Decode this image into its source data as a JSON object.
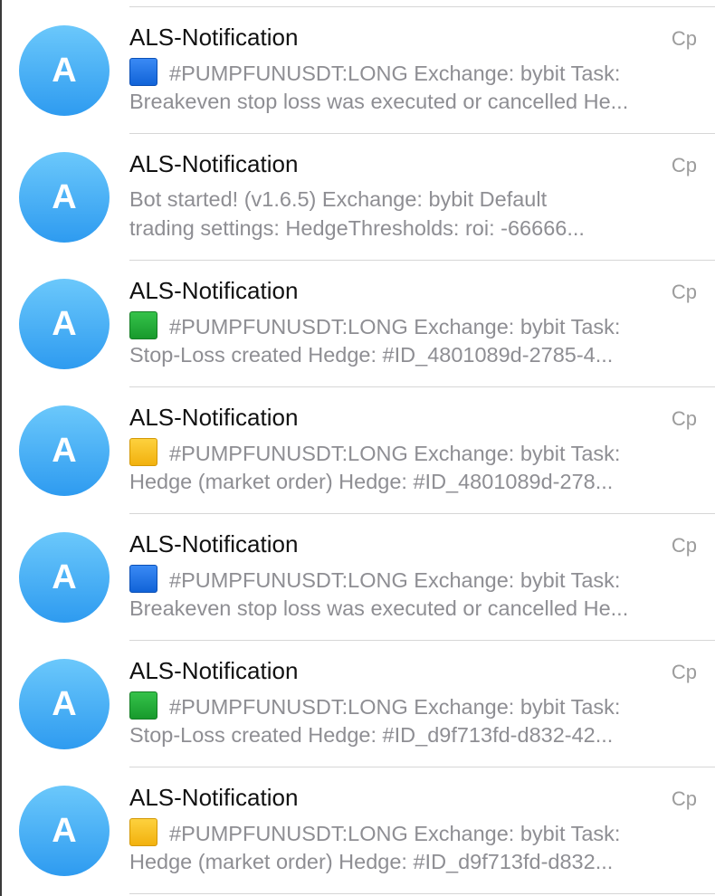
{
  "avatar_letter": "A",
  "chats": [
    {
      "name": "ALS-Notification",
      "time": "Cp",
      "icon": "blue-square-icon",
      "icon_color": "#1a6fe3",
      "line1": "#PUMPFUNUSDT:LONG Exchange: bybit Task:",
      "line2": "Breakeven stop loss was executed or cancelled He..."
    },
    {
      "name": "ALS-Notification",
      "time": "Cp",
      "icon": "",
      "icon_color": "",
      "line1": "Bot started! (v1.6.5)  Exchange: bybit  Default",
      "line2": "trading settings:  HedgeThresholds:     roi: -66666..."
    },
    {
      "name": "ALS-Notification",
      "time": "Cp",
      "icon": "green-square-icon",
      "icon_color": "#22a636",
      "line1": "#PUMPFUNUSDT:LONG Exchange: bybit Task:",
      "line2": "Stop-Loss created Hedge: #ID_4801089d-2785-4..."
    },
    {
      "name": "ALS-Notification",
      "time": "Cp",
      "icon": "yellow-square-icon",
      "icon_color": "#f7bf1c",
      "line1": "#PUMPFUNUSDT:LONG Exchange: bybit Task:",
      "line2": "Hedge (market order) Hedge: #ID_4801089d-278..."
    },
    {
      "name": "ALS-Notification",
      "time": "Cp",
      "icon": "blue-square-icon",
      "icon_color": "#1a6fe3",
      "line1": "#PUMPFUNUSDT:LONG Exchange: bybit Task:",
      "line2": "Breakeven stop loss was executed or cancelled He..."
    },
    {
      "name": "ALS-Notification",
      "time": "Cp",
      "icon": "green-square-icon",
      "icon_color": "#22a636",
      "line1": "#PUMPFUNUSDT:LONG Exchange: bybit Task:",
      "line2": "Stop-Loss created Hedge: #ID_d9f713fd-d832-42..."
    },
    {
      "name": "ALS-Notification",
      "time": "Cp",
      "icon": "yellow-square-icon",
      "icon_color": "#f7bf1c",
      "line1": "#PUMPFUNUSDT:LONG Exchange: bybit Task:",
      "line2": "Hedge (market order) Hedge: #ID_d9f713fd-d832..."
    }
  ]
}
